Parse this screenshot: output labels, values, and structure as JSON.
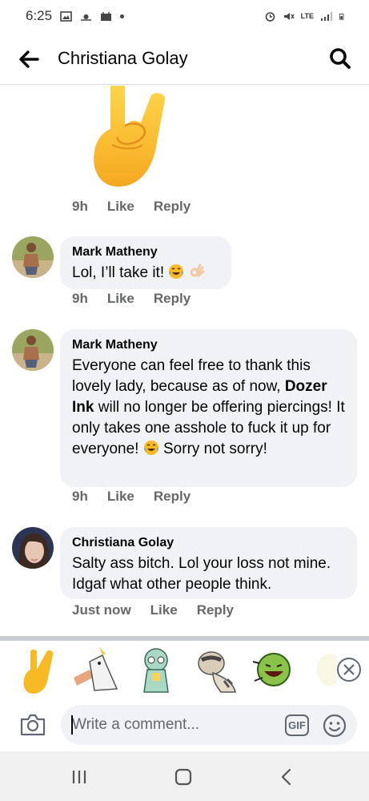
{
  "status_bar": {
    "time": "6:25",
    "network": "LTE"
  },
  "header": {
    "title": "Christiana Golay",
    "back_icon": "arrow-left-icon",
    "search_icon": "search-icon"
  },
  "comments": [
    {
      "type": "sticker",
      "sticker": "rock-on-hand-emoji",
      "time": "9h",
      "like_label": "Like",
      "reply_label": "Reply"
    },
    {
      "author": "Mark Matheny",
      "text_before": "Lol, I’ll take it!",
      "emojis": [
        "tears-of-joy-emoji",
        "ok-hand-emoji"
      ],
      "time": "9h",
      "like_label": "Like",
      "reply_label": "Reply"
    },
    {
      "author": "Mark Matheny",
      "text_part1": "Everyone can feel free to thank this lovely lady, because as of now, ",
      "text_bold": "Dozer Ink",
      "text_part2": " will no longer be offering piercings! It only takes one asshole to fuck it up for everyone! ",
      "text_part3": " Sorry not sorry!",
      "time": "9h",
      "like_label": "Like",
      "reply_label": "Reply"
    },
    {
      "author": "Christiana Golay",
      "text": "Salty ass bitch. Lol your loss not mine. Idgaf what other people think.",
      "time": "Just now",
      "like_label": "Like",
      "reply_label": "Reply"
    }
  ],
  "stickers": [
    "rock-on-hand-sticker",
    "unicorn-hand-sticker",
    "squidward-sticker",
    "raccoon-sticker",
    "tennis-ball-laughing-sticker",
    "partial-sticker"
  ],
  "composer": {
    "placeholder": "Write a comment...",
    "gif_label": "GIF",
    "camera_icon": "camera-icon",
    "emoji_icon": "smiley-icon"
  },
  "colors": {
    "bubble": "#f0f2f5",
    "meta_text": "#65676b",
    "emoji_yellow": "#f7b924"
  }
}
